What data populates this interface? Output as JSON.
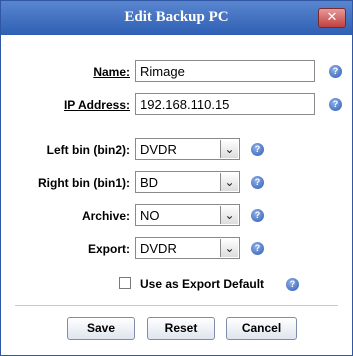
{
  "dialog": {
    "title": "Edit Backup PC",
    "close_glyph": "✕"
  },
  "fields": {
    "name": {
      "label": "Name:",
      "value": "Rimage"
    },
    "ip_address": {
      "label": "IP Address:",
      "value": "192.168.110.15"
    },
    "left_bin": {
      "label": "Left bin (bin2):",
      "value": "DVDR"
    },
    "right_bin": {
      "label": "Right bin (bin1):",
      "value": "BD"
    },
    "archive": {
      "label": "Archive:",
      "value": "NO"
    },
    "export": {
      "label": "Export:",
      "value": "DVDR"
    }
  },
  "export_default": {
    "label": "Use as Export Default",
    "checked": false
  },
  "help_glyph": "?",
  "buttons": {
    "save": "Save",
    "reset": "Reset",
    "cancel": "Cancel"
  },
  "colors": {
    "title_bar": "#2e5fb3",
    "help_icon": "#2d5cb0",
    "close": "#c04040"
  }
}
